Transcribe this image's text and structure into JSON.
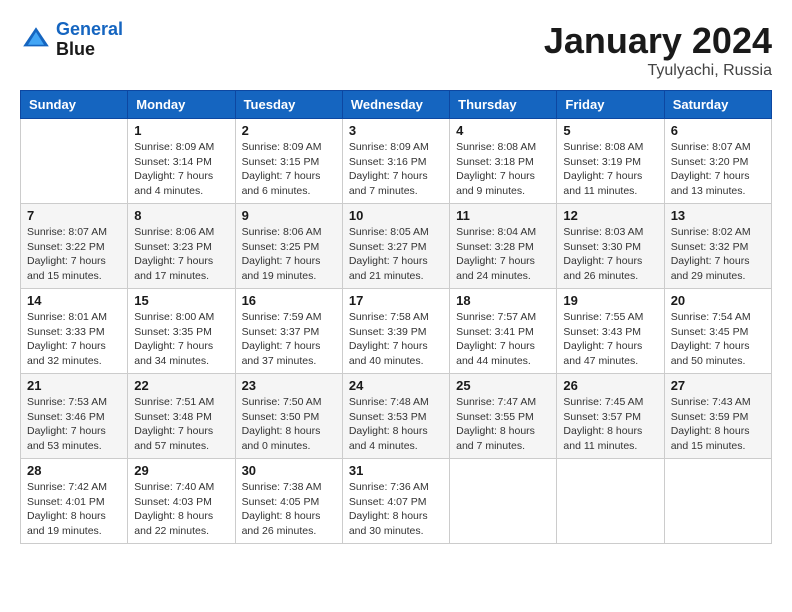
{
  "header": {
    "logo_line1": "General",
    "logo_line2": "Blue",
    "month": "January 2024",
    "location": "Tyulyachi, Russia"
  },
  "columns": [
    "Sunday",
    "Monday",
    "Tuesday",
    "Wednesday",
    "Thursday",
    "Friday",
    "Saturday"
  ],
  "weeks": [
    [
      {
        "day": "",
        "sunrise": "",
        "sunset": "",
        "daylight": ""
      },
      {
        "day": "1",
        "sunrise": "Sunrise: 8:09 AM",
        "sunset": "Sunset: 3:14 PM",
        "daylight": "Daylight: 7 hours and 4 minutes."
      },
      {
        "day": "2",
        "sunrise": "Sunrise: 8:09 AM",
        "sunset": "Sunset: 3:15 PM",
        "daylight": "Daylight: 7 hours and 6 minutes."
      },
      {
        "day": "3",
        "sunrise": "Sunrise: 8:09 AM",
        "sunset": "Sunset: 3:16 PM",
        "daylight": "Daylight: 7 hours and 7 minutes."
      },
      {
        "day": "4",
        "sunrise": "Sunrise: 8:08 AM",
        "sunset": "Sunset: 3:18 PM",
        "daylight": "Daylight: 7 hours and 9 minutes."
      },
      {
        "day": "5",
        "sunrise": "Sunrise: 8:08 AM",
        "sunset": "Sunset: 3:19 PM",
        "daylight": "Daylight: 7 hours and 11 minutes."
      },
      {
        "day": "6",
        "sunrise": "Sunrise: 8:07 AM",
        "sunset": "Sunset: 3:20 PM",
        "daylight": "Daylight: 7 hours and 13 minutes."
      }
    ],
    [
      {
        "day": "7",
        "sunrise": "Sunrise: 8:07 AM",
        "sunset": "Sunset: 3:22 PM",
        "daylight": "Daylight: 7 hours and 15 minutes."
      },
      {
        "day": "8",
        "sunrise": "Sunrise: 8:06 AM",
        "sunset": "Sunset: 3:23 PM",
        "daylight": "Daylight: 7 hours and 17 minutes."
      },
      {
        "day": "9",
        "sunrise": "Sunrise: 8:06 AM",
        "sunset": "Sunset: 3:25 PM",
        "daylight": "Daylight: 7 hours and 19 minutes."
      },
      {
        "day": "10",
        "sunrise": "Sunrise: 8:05 AM",
        "sunset": "Sunset: 3:27 PM",
        "daylight": "Daylight: 7 hours and 21 minutes."
      },
      {
        "day": "11",
        "sunrise": "Sunrise: 8:04 AM",
        "sunset": "Sunset: 3:28 PM",
        "daylight": "Daylight: 7 hours and 24 minutes."
      },
      {
        "day": "12",
        "sunrise": "Sunrise: 8:03 AM",
        "sunset": "Sunset: 3:30 PM",
        "daylight": "Daylight: 7 hours and 26 minutes."
      },
      {
        "day": "13",
        "sunrise": "Sunrise: 8:02 AM",
        "sunset": "Sunset: 3:32 PM",
        "daylight": "Daylight: 7 hours and 29 minutes."
      }
    ],
    [
      {
        "day": "14",
        "sunrise": "Sunrise: 8:01 AM",
        "sunset": "Sunset: 3:33 PM",
        "daylight": "Daylight: 7 hours and 32 minutes."
      },
      {
        "day": "15",
        "sunrise": "Sunrise: 8:00 AM",
        "sunset": "Sunset: 3:35 PM",
        "daylight": "Daylight: 7 hours and 34 minutes."
      },
      {
        "day": "16",
        "sunrise": "Sunrise: 7:59 AM",
        "sunset": "Sunset: 3:37 PM",
        "daylight": "Daylight: 7 hours and 37 minutes."
      },
      {
        "day": "17",
        "sunrise": "Sunrise: 7:58 AM",
        "sunset": "Sunset: 3:39 PM",
        "daylight": "Daylight: 7 hours and 40 minutes."
      },
      {
        "day": "18",
        "sunrise": "Sunrise: 7:57 AM",
        "sunset": "Sunset: 3:41 PM",
        "daylight": "Daylight: 7 hours and 44 minutes."
      },
      {
        "day": "19",
        "sunrise": "Sunrise: 7:55 AM",
        "sunset": "Sunset: 3:43 PM",
        "daylight": "Daylight: 7 hours and 47 minutes."
      },
      {
        "day": "20",
        "sunrise": "Sunrise: 7:54 AM",
        "sunset": "Sunset: 3:45 PM",
        "daylight": "Daylight: 7 hours and 50 minutes."
      }
    ],
    [
      {
        "day": "21",
        "sunrise": "Sunrise: 7:53 AM",
        "sunset": "Sunset: 3:46 PM",
        "daylight": "Daylight: 7 hours and 53 minutes."
      },
      {
        "day": "22",
        "sunrise": "Sunrise: 7:51 AM",
        "sunset": "Sunset: 3:48 PM",
        "daylight": "Daylight: 7 hours and 57 minutes."
      },
      {
        "day": "23",
        "sunrise": "Sunrise: 7:50 AM",
        "sunset": "Sunset: 3:50 PM",
        "daylight": "Daylight: 8 hours and 0 minutes."
      },
      {
        "day": "24",
        "sunrise": "Sunrise: 7:48 AM",
        "sunset": "Sunset: 3:53 PM",
        "daylight": "Daylight: 8 hours and 4 minutes."
      },
      {
        "day": "25",
        "sunrise": "Sunrise: 7:47 AM",
        "sunset": "Sunset: 3:55 PM",
        "daylight": "Daylight: 8 hours and 7 minutes."
      },
      {
        "day": "26",
        "sunrise": "Sunrise: 7:45 AM",
        "sunset": "Sunset: 3:57 PM",
        "daylight": "Daylight: 8 hours and 11 minutes."
      },
      {
        "day": "27",
        "sunrise": "Sunrise: 7:43 AM",
        "sunset": "Sunset: 3:59 PM",
        "daylight": "Daylight: 8 hours and 15 minutes."
      }
    ],
    [
      {
        "day": "28",
        "sunrise": "Sunrise: 7:42 AM",
        "sunset": "Sunset: 4:01 PM",
        "daylight": "Daylight: 8 hours and 19 minutes."
      },
      {
        "day": "29",
        "sunrise": "Sunrise: 7:40 AM",
        "sunset": "Sunset: 4:03 PM",
        "daylight": "Daylight: 8 hours and 22 minutes."
      },
      {
        "day": "30",
        "sunrise": "Sunrise: 7:38 AM",
        "sunset": "Sunset: 4:05 PM",
        "daylight": "Daylight: 8 hours and 26 minutes."
      },
      {
        "day": "31",
        "sunrise": "Sunrise: 7:36 AM",
        "sunset": "Sunset: 4:07 PM",
        "daylight": "Daylight: 8 hours and 30 minutes."
      },
      {
        "day": "",
        "sunrise": "",
        "sunset": "",
        "daylight": ""
      },
      {
        "day": "",
        "sunrise": "",
        "sunset": "",
        "daylight": ""
      },
      {
        "day": "",
        "sunrise": "",
        "sunset": "",
        "daylight": ""
      }
    ]
  ]
}
